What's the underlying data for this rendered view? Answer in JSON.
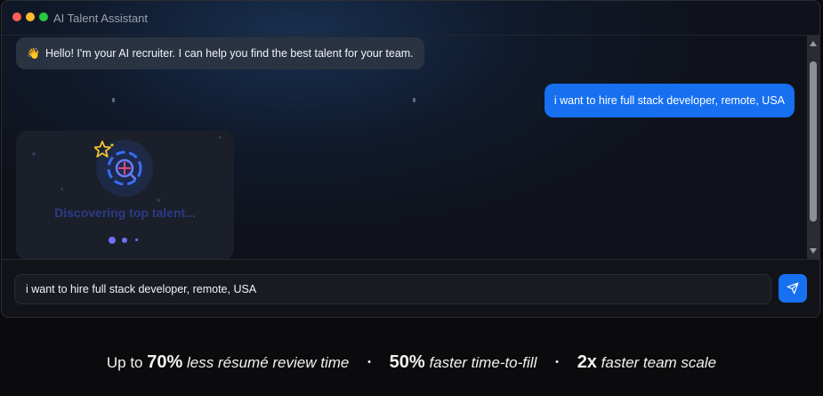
{
  "window": {
    "title": "AI Talent Assistant",
    "controls": {
      "close_color": "#ff5f57",
      "minimize_color": "#febc2e",
      "maximize_color": "#28c840"
    }
  },
  "chat": {
    "ai_greeting": {
      "icon": "waving-hand-icon",
      "text": "Hello! I'm your AI recruiter. I can help you find the best talent for your team."
    },
    "user_message": "i want to hire full stack developer, remote, USA",
    "loader": {
      "icon": "talent-search-icon",
      "text": "Discovering top talent..."
    }
  },
  "composer": {
    "input_value": "i want to hire full stack developer, remote, USA",
    "send_icon": "send-icon",
    "accent": "#1670f0"
  },
  "stats": {
    "item1": {
      "prefix": "Up to",
      "value": "70%",
      "desc": "less résumé review time"
    },
    "item2": {
      "value": "50%",
      "desc": "faster time-to-fill"
    },
    "item3": {
      "value": "2x",
      "desc": "faster team scale"
    },
    "separator": "•"
  }
}
